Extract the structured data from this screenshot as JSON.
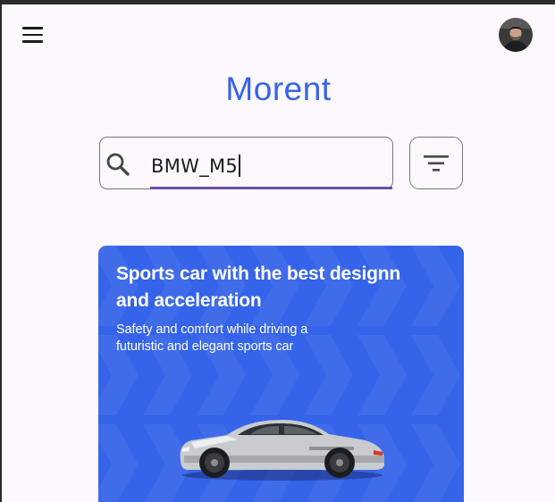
{
  "app": {
    "brand": "Morent"
  },
  "header": {
    "menu_icon": "hamburger-menu-icon",
    "avatar_icon": "user-avatar"
  },
  "search": {
    "value": "BMW_M5",
    "icon": "search-icon"
  },
  "filter": {
    "icon": "filter-icon"
  },
  "promo": {
    "title": "Sports car with the best designn and acceleration",
    "subtitle": "Safety and comfort while driving a futuristic and elegant sports car",
    "image": "silver-sports-car"
  },
  "colors": {
    "brand_blue": "#3563e9",
    "background": "#fdf8fd",
    "input_underline": "#6750a4",
    "outline": "#79747e"
  }
}
